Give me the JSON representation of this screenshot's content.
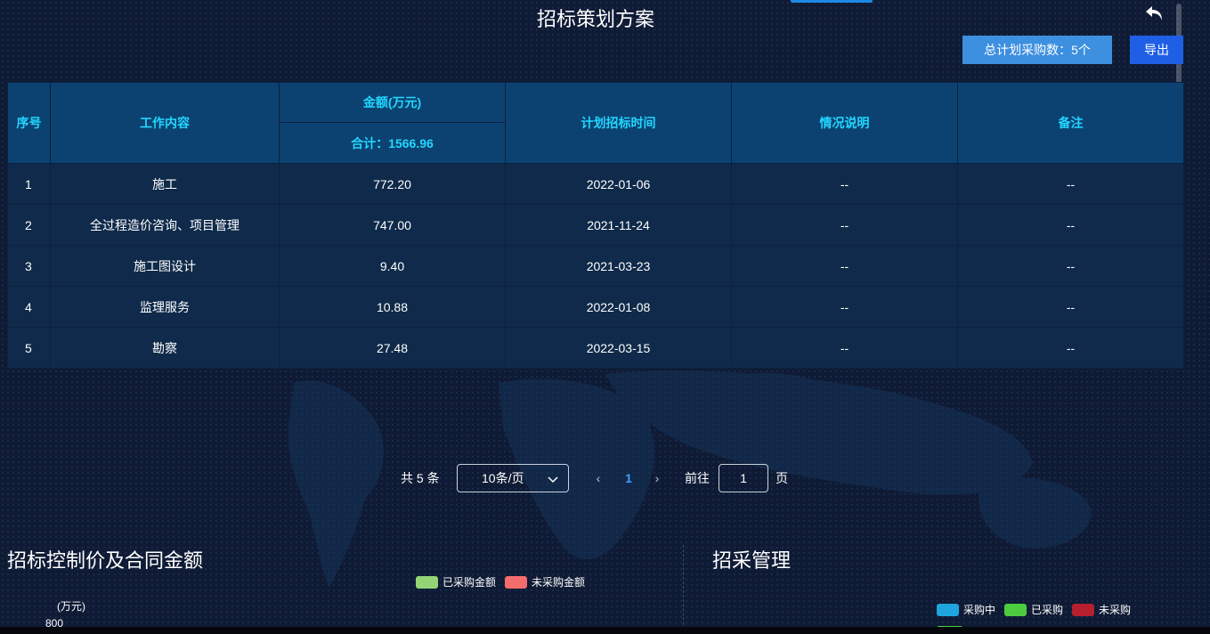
{
  "page": {
    "title": "招标策划方案",
    "total_button": "总计划采购数：5个",
    "export_button": "导出"
  },
  "table": {
    "headers": {
      "index": "序号",
      "work": "工作内容",
      "amount": "金额(万元)",
      "amount_total": "合计：1566.96",
      "time": "计划招标时间",
      "desc": "情况说明",
      "note": "备注"
    },
    "rows": [
      {
        "index": "1",
        "work": "施工",
        "amount": "772.20",
        "time": "2022-01-06",
        "desc": "--",
        "note": "--"
      },
      {
        "index": "2",
        "work": "全过程造价咨询、项目管理",
        "amount": "747.00",
        "time": "2021-11-24",
        "desc": "--",
        "note": "--"
      },
      {
        "index": "3",
        "work": "施工图设计",
        "amount": "9.40",
        "time": "2021-03-23",
        "desc": "--",
        "note": "--"
      },
      {
        "index": "4",
        "work": "监理服务",
        "amount": "10.88",
        "time": "2022-01-08",
        "desc": "--",
        "note": "--"
      },
      {
        "index": "5",
        "work": "勘察",
        "amount": "27.48",
        "time": "2022-03-15",
        "desc": "--",
        "note": "--"
      }
    ]
  },
  "pagination": {
    "total": "共 5 条",
    "page_size": "10条/页",
    "prev_icon": "‹",
    "current_page": "1",
    "next_icon": "›",
    "goto_label": "前往",
    "goto_value": "1",
    "page_unit": "页"
  },
  "left_panel": {
    "title": "招标控制价及合同金额",
    "legend": [
      {
        "label": "已采购金额",
        "color": "#95d475"
      },
      {
        "label": "未采购金额",
        "color": "#f56c6c"
      }
    ],
    "y_unit": "(万元)",
    "y_tick_top": "800"
  },
  "right_panel": {
    "title": "招采管理",
    "legend": [
      {
        "label": "采购中",
        "color": "#1ea5e0"
      },
      {
        "label": "已采购",
        "color": "#4ccd3f"
      },
      {
        "label": "未采购",
        "color": "#b51f2e"
      }
    ]
  },
  "icons": {
    "back": "undo-arrow-icon",
    "select": "chevron-down-icon"
  }
}
